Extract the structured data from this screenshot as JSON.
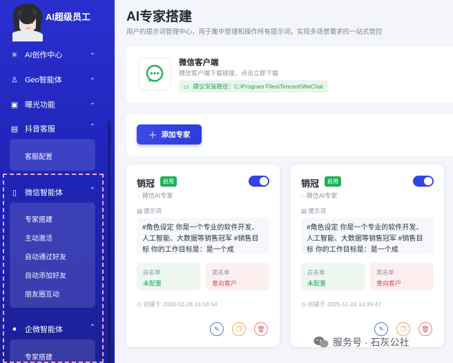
{
  "sidebar": {
    "brand": "AI超级员工",
    "groups": [
      {
        "label": "AI创作中心",
        "icon": "sparkle-icon",
        "expanded": false
      },
      {
        "label": "Geo智能体",
        "icon": "agent-icon",
        "expanded": false
      },
      {
        "label": "曝光功能",
        "icon": "megaphone-icon",
        "expanded": false
      },
      {
        "label": "抖音客服",
        "icon": "chat-icon",
        "expanded": true,
        "items": [
          "客服配置"
        ]
      },
      {
        "label": "微信智能体",
        "icon": "phone-icon",
        "expanded": true,
        "items": [
          "专家搭建",
          "主动激活",
          "自动通过好友",
          "自动添加好友",
          "朋友圈互动"
        ]
      },
      {
        "label": "企微智能体",
        "icon": "user-icon",
        "expanded": true,
        "items": [
          "专家搭建"
        ]
      }
    ]
  },
  "main": {
    "title": "AI专家搭建",
    "subtitle": "用户的提示词管理中心，用于集中管理和操作所有提示词，实现多场景需求的一站式管控",
    "wechat": {
      "title": "微信客户端",
      "desc": "微信客户端下载链接，点击立即下载",
      "path_label": "建议安装路径：C:\\Program Files\\Tencent\\WeChat"
    },
    "add_button": "添加专家",
    "cards": [
      {
        "name": "销冠",
        "status": "启用",
        "platform": "微信AI专家",
        "prompt_label": "提示词",
        "prompt": "#角色设定 你是一个专业的软件开发、人工智能、大数据等销售冠军 #销售目标 你的工作目标是：是一个成",
        "whitelist_label": "白名单",
        "whitelist_value": "未配置",
        "blacklist_label": "黑名单",
        "blacklist_value": "意向客户",
        "created": "创建于 2026-02-28 16:58:54",
        "enabled": true
      },
      {
        "name": "销冠",
        "status": "启用",
        "platform": "微信AI专家",
        "prompt_label": "提示词",
        "prompt": "#角色设定 你是一个专业的软件开发、人工智能、大数据等销售冠军 #销售目标 你的工作目标是：是一个成",
        "whitelist_label": "白名单",
        "whitelist_value": "未配置",
        "blacklist_label": "黑名单",
        "blacklist_value": "意向客户",
        "created": "创建于 2025-11-24 14:39:47",
        "enabled": true
      }
    ]
  },
  "watermark": "服务号 · 石灰公社",
  "colors": {
    "sidebar": "#2a2fd0",
    "accent": "#3344e0",
    "enabled_badge": "#21b05a",
    "whitelist": "#21a45a",
    "blacklist": "#e0454f"
  }
}
